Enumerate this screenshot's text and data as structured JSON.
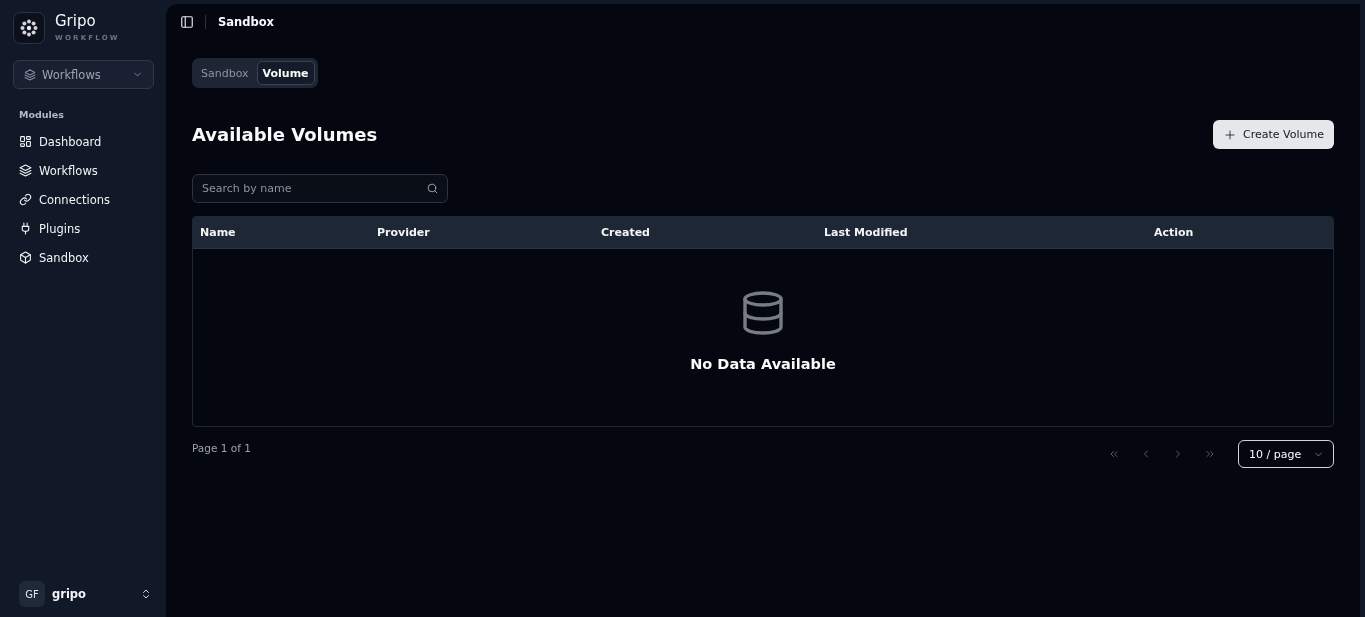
{
  "sidebar": {
    "brand": {
      "name": "Gripo",
      "subtitle": "WORKFLOW"
    },
    "switcher": {
      "label": "Workflows"
    },
    "section_label": "Modules",
    "items": [
      {
        "label": "Dashboard",
        "selected": false
      },
      {
        "label": "Workflows",
        "selected": false
      },
      {
        "label": "Connections",
        "selected": false
      },
      {
        "label": "Plugins",
        "selected": false
      },
      {
        "label": "Sandbox",
        "selected": false
      }
    ],
    "user": {
      "initials": "GF",
      "name": "gripo"
    }
  },
  "header": {
    "breadcrumb": "Sandbox"
  },
  "tabs": [
    {
      "label": "Sandbox",
      "selected": false
    },
    {
      "label": "Volume",
      "selected": true
    }
  ],
  "page": {
    "title": "Available Volumes",
    "create_button": "Create Volume",
    "search": {
      "placeholder": "Search by name"
    }
  },
  "table": {
    "columns": [
      "Name",
      "Provider",
      "Created",
      "Last Modified",
      "Action"
    ],
    "empty_message": "No Data Available"
  },
  "footer": {
    "page_info": "Page 1 of 1",
    "pagination": [
      {
        "kind": "first",
        "disabled": true
      },
      {
        "kind": "previous",
        "disabled": true
      },
      {
        "kind": "next",
        "disabled": true
      },
      {
        "kind": "last",
        "disabled": true
      }
    ],
    "page_size": "10 / page"
  }
}
